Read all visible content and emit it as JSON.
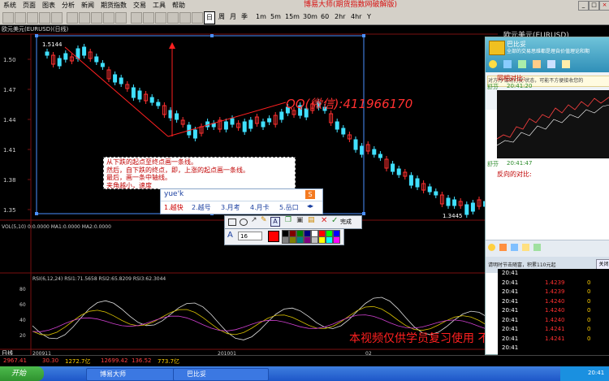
{
  "menu": {
    "items": [
      "系统",
      "页面",
      "图表",
      "分析",
      "新闻",
      "期货指数",
      "交易",
      "工具",
      "帮助"
    ],
    "app_title": "博易大师(期货指数网破解版)",
    "window_controls": [
      "_",
      "□",
      "×"
    ]
  },
  "toolbar": {
    "periods": [
      "日",
      "周",
      "月",
      "季",
      "1m",
      "5m",
      "15m",
      "30m",
      "60",
      "2hr",
      "4hr",
      "Y"
    ],
    "selected_period": "日"
  },
  "chart": {
    "title": "欧元美元(EURUSD)(日线)",
    "right_title": "欧元美元(EURUSD)",
    "y_ticks": [
      "1.50",
      "1.47",
      "1.44",
      "1.41",
      "1.38",
      "1.35"
    ],
    "high_label": "1.5144",
    "low_label": "1.3445",
    "watermark": "QQ(微信):411966170",
    "vol_label": "VOL(5,10) 0:0.0000 MA1:0.0000 MA2:0.0000",
    "rsi_label": "RSI(6,12,24) RSI1:71.5658 RSI2:65.8209 RSI3:62.3044",
    "rsi_ticks": [
      "80",
      "60",
      "40",
      "20"
    ],
    "x_labels": [
      "日线",
      "200911",
      "201001",
      "02"
    ],
    "disclaimer": "本视频仅供学员复习使用 不得传播"
  },
  "annotation": {
    "lines": [
      "从下跌的起点至终点画一条线。",
      "然后，自下跌的终点，即，上涨的起点画一条线。",
      "最后，画一条中轴线。",
      "夹角越小，速度"
    ]
  },
  "ime": {
    "input": "yue'k",
    "candidates": [
      "1.越快",
      "2.越号",
      "3.月考",
      "4.月卡",
      "5.岳口"
    ]
  },
  "drawbar": {
    "done_label": "完成"
  },
  "colorbar": {
    "font_icon": "A",
    "font_size": "16",
    "colors": [
      "#ff0000",
      "#000000",
      "#808080",
      "#800000",
      "#808000",
      "#008000",
      "#008080",
      "#000080",
      "#800080",
      "#ffffff",
      "#c0c0c0",
      "#ff0000",
      "#ffff00",
      "#00ff00",
      "#00ffff",
      "#0000ff",
      "#ff00ff"
    ]
  },
  "chat": {
    "title": "巴比妥",
    "subtitle": "全部的交易思维都是理自价值理论和期",
    "notice": "对方为'请勿打扰'状态，可能不方便接收您的",
    "messages": [
      {
        "text": "同相对比:",
        "color": "#c00000"
      },
      {
        "sender": "舒芬",
        "time": "20:41:20"
      },
      {
        "sender": "舒芬",
        "time": "20:41:47"
      },
      {
        "text": "反向的对比:",
        "color": "#c00000"
      }
    ],
    "input_hint": "请明时节击随富，积累110元起",
    "close_label": "关闭"
  },
  "ticks": [
    {
      "t": "20:41",
      "p": "",
      "v": ""
    },
    {
      "t": "20:41",
      "p": "1.4239",
      "v": "0"
    },
    {
      "t": "20:41",
      "p": "1.4239",
      "v": "0"
    },
    {
      "t": "20:41",
      "p": "1.4240",
      "v": "0"
    },
    {
      "t": "20:41",
      "p": "1.4240",
      "v": "0"
    },
    {
      "t": "20:41",
      "p": "1.4240",
      "v": "0"
    },
    {
      "t": "20:41",
      "p": "1.4241",
      "v": "0"
    },
    {
      "t": "20:41",
      "p": "1.4241",
      "v": "0"
    },
    {
      "t": "20:41",
      "p": "",
      "v": ""
    }
  ],
  "status": {
    "items": [
      "2967.41",
      "30.30",
      "1272.7亿",
      "12699.42",
      "136.52",
      "773.7亿"
    ]
  },
  "taskbar": {
    "start": "开始",
    "tasks": [
      "博易大师",
      "巴比妥"
    ],
    "clock": "20:41"
  }
}
